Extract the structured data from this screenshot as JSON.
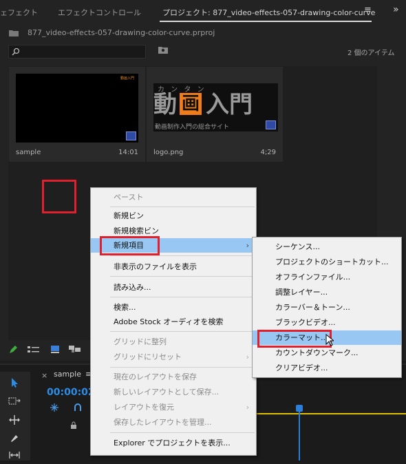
{
  "tabs": {
    "effects": "ェフェクト",
    "effect_controls": "エフェクトコントロール",
    "project": "プロジェクト: 877_video-effects-057-drawing-color-curve",
    "menu_icon": "≡",
    "overflow_icon": "»"
  },
  "project": {
    "path": "877_video-effects-057-drawing-color-curve.prproj",
    "item_count": "2 個のアイテム",
    "search_value": ""
  },
  "items": [
    {
      "name": "sample",
      "duration": "14:01",
      "thumb_label": "動画入門"
    },
    {
      "name": "logo.png",
      "duration": "4;29"
    }
  ],
  "logo": {
    "kana": "カ ン タ ン",
    "big1": "動",
    "big2": "画",
    "big3": "入門",
    "sub": "動画制作入門の総合サイト"
  },
  "timeline": {
    "sequence_tab": "sample",
    "sequence_menu": "≡",
    "close": "×",
    "timecode": "00:00:02"
  },
  "context_menu": {
    "items": [
      {
        "label": "ペースト",
        "disabled": true
      },
      {
        "label": "新規ビン",
        "disabled": false
      },
      {
        "label": "新規検索ビン",
        "disabled": false
      },
      {
        "label": "新規項目",
        "disabled": false,
        "submenu": true
      },
      {
        "label": "非表示のファイルを表示",
        "disabled": false
      },
      {
        "label": "読み込み...",
        "disabled": false
      },
      {
        "label": "検索...",
        "disabled": false
      },
      {
        "label": "Adobe Stock オーディオを検索",
        "disabled": false
      },
      {
        "label": "グリッドに整列",
        "disabled": true
      },
      {
        "label": "グリッドにリセット",
        "disabled": true,
        "submenu": true
      },
      {
        "label": "現在のレイアウトを保存",
        "disabled": true
      },
      {
        "label": "新しいレイアウトとして保存...",
        "disabled": true
      },
      {
        "label": "レイアウトを復元",
        "disabled": true,
        "submenu": true
      },
      {
        "label": "保存したレイアウトを管理...",
        "disabled": true
      },
      {
        "label": "Explorer でプロジェクトを表示...",
        "disabled": false
      }
    ]
  },
  "submenu": {
    "items": [
      "シーケンス...",
      "プロジェクトのショートカット...",
      "オフラインファイル...",
      "調整レイヤー...",
      "カラーバー＆トーン...",
      "ブラックビデオ...",
      "カラーマット...",
      "カウントダウンマーク...",
      "クリアビデオ..."
    ],
    "highlighted": "カラーマット..."
  },
  "colors": {
    "highlight": "#97c7f2",
    "annotation_red": "#e0202c",
    "playhead": "#2c7fd9",
    "work_area": "#e0c000",
    "logo_orange": "#f07d1a"
  }
}
